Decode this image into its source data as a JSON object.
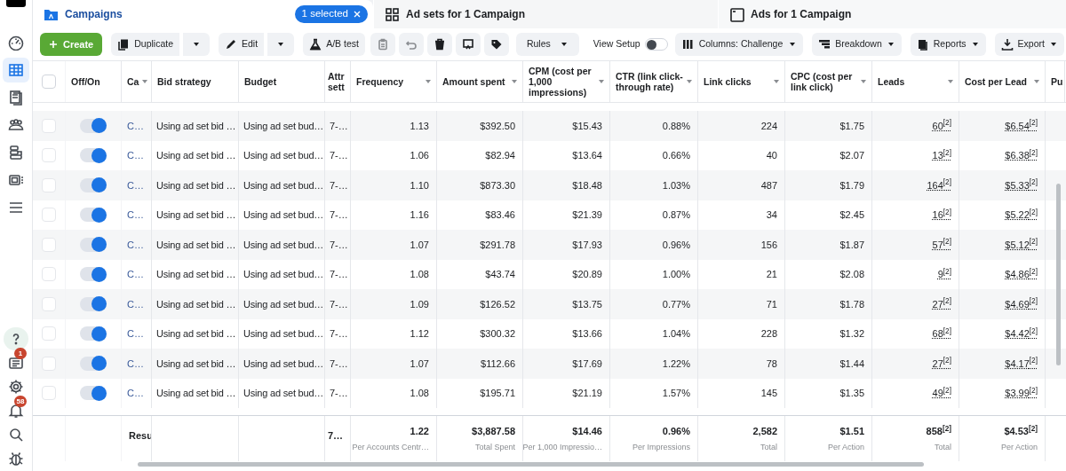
{
  "sidebar": {
    "items": [
      {
        "selected": false
      },
      {
        "selected": true
      },
      {
        "selected": false
      },
      {
        "selected": false
      },
      {
        "selected": false
      },
      {
        "selected": false
      },
      {
        "selected": false
      }
    ],
    "bottom_items": [
      {
        "selected": false
      },
      {
        "selected": false,
        "badge": "1"
      },
      {
        "selected": false
      },
      {
        "selected": false,
        "badge": "58"
      },
      {
        "selected": false
      },
      {
        "selected": false
      }
    ]
  },
  "tabs": [
    {
      "label": "Campaigns",
      "selected": true
    },
    {
      "label": "Ad sets for 1 Campaign",
      "selected": false
    },
    {
      "label": "Ads for 1 Campaign",
      "selected": false
    }
  ],
  "selection_chip": {
    "label": "1 selected"
  },
  "toolbar": {
    "create": "Create",
    "duplicate": "Duplicate",
    "edit": "Edit",
    "ab_test": "A/B test",
    "rules": "Rules",
    "view_setup": {
      "label": "View Setup",
      "on": false
    },
    "columns": "Columns: Challenge",
    "breakdown": "Breakdown",
    "reports": "Reports",
    "export": "Export"
  },
  "table": {
    "header_checked": false,
    "columns": [
      {
        "label": "Off/On",
        "caret": false
      },
      {
        "label": "Ca",
        "caret": true
      },
      {
        "label": "Bid strategy",
        "caret": false
      },
      {
        "label": "Budget",
        "caret": false
      },
      {
        "label": "Attr sett",
        "caret": false
      },
      {
        "label": "Frequency",
        "caret": true
      },
      {
        "label": "Amount spent",
        "caret": true
      },
      {
        "label": "CPM (cost per 1,000 impressions)",
        "caret": true
      },
      {
        "label": "CTR (link click-through rate)",
        "caret": true
      },
      {
        "label": "Link clicks",
        "caret": true
      },
      {
        "label": "CPC (cost per link click)",
        "caret": true
      },
      {
        "label": "Leads",
        "caret": true
      },
      {
        "label": "Cost per Lead",
        "caret": true
      },
      {
        "label": "Pu"
      }
    ],
    "rows": [
      {
        "checked": false,
        "on": true,
        "name": "C…",
        "bid_strategy": "Using ad set bid …",
        "budget": "Using ad set bud…",
        "attribution": "7-…",
        "frequency": "1.13",
        "amount_spent": "$392.50",
        "cpm": "$15.43",
        "ctr": "0.88%",
        "link_clicks": "224",
        "cpc": "$1.75",
        "leads": "60$^{[2]}$",
        "cost_per_lead": "$6.54$^{[2]}$"
      },
      {
        "checked": false,
        "on": true,
        "name": "C…",
        "bid_strategy": "Using ad set bid …",
        "budget": "Using ad set bud…",
        "attribution": "7-…",
        "frequency": "1.06",
        "amount_spent": "$82.94",
        "cpm": "$13.64",
        "ctr": "0.66%",
        "link_clicks": "40",
        "cpc": "$2.07",
        "leads": "13$^{[2]}$",
        "cost_per_lead": "$6.38$^{[2]}$"
      },
      {
        "checked": false,
        "on": true,
        "name": "C…",
        "bid_strategy": "Using ad set bid …",
        "budget": "Using ad set bud…",
        "attribution": "7-…",
        "frequency": "1.10",
        "amount_spent": "$873.30",
        "cpm": "$18.48",
        "ctr": "1.03%",
        "link_clicks": "487",
        "cpc": "$1.79",
        "leads": "164$^{[2]}$",
        "cost_per_lead": "$5.33$^{[2]}$"
      },
      {
        "checked": false,
        "on": true,
        "name": "C…",
        "bid_strategy": "Using ad set bid …",
        "budget": "Using ad set bud…",
        "attribution": "7-…",
        "frequency": "1.16",
        "amount_spent": "$83.46",
        "cpm": "$21.39",
        "ctr": "0.87%",
        "link_clicks": "34",
        "cpc": "$2.45",
        "leads": "16$^{[2]}$",
        "cost_per_lead": "$5.22$^{[2]}$"
      },
      {
        "checked": false,
        "on": true,
        "name": "C…",
        "bid_strategy": "Using ad set bid …",
        "budget": "Using ad set bud…",
        "attribution": "7-…",
        "frequency": "1.07",
        "amount_spent": "$291.78",
        "cpm": "$17.93",
        "ctr": "0.96%",
        "link_clicks": "156",
        "cpc": "$1.87",
        "leads": "57$^{[2]}$",
        "cost_per_lead": "$5.12$^{[2]}$"
      },
      {
        "checked": false,
        "on": true,
        "name": "C…",
        "bid_strategy": "Using ad set bid …",
        "budget": "Using ad set bud…",
        "attribution": "7-…",
        "frequency": "1.08",
        "amount_spent": "$43.74",
        "cpm": "$20.89",
        "ctr": "1.00%",
        "link_clicks": "21",
        "cpc": "$2.08",
        "leads": "9$^{[2]}$",
        "cost_per_lead": "$4.86$^{[2]}$"
      },
      {
        "checked": false,
        "on": true,
        "name": "C…",
        "bid_strategy": "Using ad set bid …",
        "budget": "Using ad set bud…",
        "attribution": "7-…",
        "frequency": "1.09",
        "amount_spent": "$126.52",
        "cpm": "$13.75",
        "ctr": "0.77%",
        "link_clicks": "71",
        "cpc": "$1.78",
        "leads": "27$^{[2]}$",
        "cost_per_lead": "$4.69$^{[2]}$"
      },
      {
        "checked": false,
        "on": true,
        "name": "C…",
        "bid_strategy": "Using ad set bid …",
        "budget": "Using ad set bud…",
        "attribution": "7-…",
        "frequency": "1.12",
        "amount_spent": "$300.32",
        "cpm": "$13.66",
        "ctr": "1.04%",
        "link_clicks": "228",
        "cpc": "$1.32",
        "leads": "68$^{[2]}$",
        "cost_per_lead": "$4.42$^{[2]}$"
      },
      {
        "checked": false,
        "on": true,
        "name": "C…",
        "bid_strategy": "Using ad set bid …",
        "budget": "Using ad set bud…",
        "attribution": "7-…",
        "frequency": "1.07",
        "amount_spent": "$112.66",
        "cpm": "$17.69",
        "ctr": "1.22%",
        "link_clicks": "78",
        "cpc": "$1.44",
        "leads": "27$^{[2]}$",
        "cost_per_lead": "$4.17$^{[2]}$"
      },
      {
        "checked": false,
        "on": true,
        "name": "C…",
        "bid_strategy": "Using ad set bid …",
        "budget": "Using ad set bud…",
        "attribution": "7-…",
        "frequency": "1.08",
        "amount_spent": "$195.71",
        "cpm": "$21.19",
        "ctr": "1.57%",
        "link_clicks": "145",
        "cpc": "$1.35",
        "leads": "49$^{[2]}$",
        "cost_per_lead": "$3.99$^{[2]}$"
      }
    ],
    "footer": {
      "label": "Resu",
      "attribution": "7…",
      "cells": [
        {
          "value": "1.22",
          "caption": "Per Accounts Centr…"
        },
        {
          "value": "$3,887.58",
          "caption": "Total Spent"
        },
        {
          "value": "$14.46",
          "caption": "Per 1,000 Impressio…"
        },
        {
          "value": "0.96%",
          "caption": "Per Impressions"
        },
        {
          "value": "2,582",
          "caption": "Total"
        },
        {
          "value": "$1.51",
          "caption": "Per Action"
        },
        {
          "value": "858$^{[2]}$",
          "caption": "Total"
        },
        {
          "value": "$4.53$^{[2]}$",
          "caption": "Per Action"
        }
      ]
    }
  }
}
